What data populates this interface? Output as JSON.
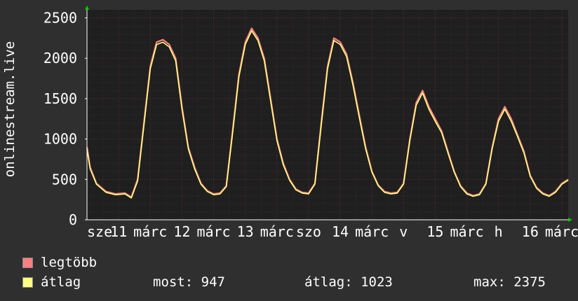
{
  "chart_data": {
    "type": "line",
    "ylabel": "onlinestream.live",
    "ylim": [
      0,
      2600
    ],
    "yticks": [
      0,
      500,
      1000,
      1500,
      2000,
      2500
    ],
    "xlim": [
      0,
      7.6
    ],
    "grid": true,
    "xtick_labels": [
      {
        "x": 0.0,
        "label": "sze"
      },
      {
        "x": 0.5,
        "label": "11"
      },
      {
        "x": 1.0,
        "label": "márc"
      },
      {
        "x": 1.5,
        "label": "12"
      },
      {
        "x": 2.0,
        "label": "márc"
      },
      {
        "x": 2.5,
        "label": "13"
      },
      {
        "x": 3.0,
        "label": "márc"
      },
      {
        "x": 3.5,
        "label": "szo"
      },
      {
        "x": 4.0,
        "label": "14"
      },
      {
        "x": 4.5,
        "label": "márc"
      },
      {
        "x": 5.0,
        "label": "v"
      },
      {
        "x": 5.5,
        "label": "15"
      },
      {
        "x": 6.0,
        "label": "márc"
      },
      {
        "x": 6.5,
        "label": "h"
      },
      {
        "x": 7.0,
        "label": "16"
      },
      {
        "x": 7.5,
        "label": "márc"
      }
    ],
    "series": [
      {
        "name": "legtöbb",
        "color": "#ff8080",
        "points": [
          [
            0.0,
            900
          ],
          [
            0.05,
            650
          ],
          [
            0.15,
            450
          ],
          [
            0.3,
            350
          ],
          [
            0.45,
            320
          ],
          [
            0.6,
            330
          ],
          [
            0.7,
            280
          ],
          [
            0.8,
            500
          ],
          [
            0.9,
            1200
          ],
          [
            1.0,
            1900
          ],
          [
            1.1,
            2200
          ],
          [
            1.2,
            2230
          ],
          [
            1.3,
            2170
          ],
          [
            1.4,
            2000
          ],
          [
            1.5,
            1400
          ],
          [
            1.6,
            900
          ],
          [
            1.7,
            650
          ],
          [
            1.8,
            450
          ],
          [
            1.9,
            360
          ],
          [
            2.0,
            320
          ],
          [
            2.1,
            330
          ],
          [
            2.2,
            420
          ],
          [
            2.3,
            1100
          ],
          [
            2.4,
            1800
          ],
          [
            2.5,
            2200
          ],
          [
            2.6,
            2370
          ],
          [
            2.7,
            2250
          ],
          [
            2.8,
            2000
          ],
          [
            2.9,
            1500
          ],
          [
            3.0,
            1000
          ],
          [
            3.1,
            700
          ],
          [
            3.2,
            500
          ],
          [
            3.3,
            380
          ],
          [
            3.4,
            340
          ],
          [
            3.5,
            330
          ],
          [
            3.6,
            450
          ],
          [
            3.7,
            1200
          ],
          [
            3.8,
            1900
          ],
          [
            3.9,
            2250
          ],
          [
            4.0,
            2200
          ],
          [
            4.1,
            2050
          ],
          [
            4.2,
            1700
          ],
          [
            4.3,
            1300
          ],
          [
            4.4,
            900
          ],
          [
            4.5,
            600
          ],
          [
            4.6,
            430
          ],
          [
            4.7,
            350
          ],
          [
            4.8,
            330
          ],
          [
            4.9,
            340
          ],
          [
            5.0,
            450
          ],
          [
            5.1,
            1000
          ],
          [
            5.2,
            1450
          ],
          [
            5.3,
            1600
          ],
          [
            5.4,
            1400
          ],
          [
            5.5,
            1250
          ],
          [
            5.6,
            1100
          ],
          [
            5.7,
            850
          ],
          [
            5.8,
            600
          ],
          [
            5.9,
            420
          ],
          [
            6.0,
            330
          ],
          [
            6.1,
            300
          ],
          [
            6.2,
            320
          ],
          [
            6.3,
            450
          ],
          [
            6.4,
            900
          ],
          [
            6.5,
            1250
          ],
          [
            6.6,
            1400
          ],
          [
            6.7,
            1250
          ],
          [
            6.8,
            1050
          ],
          [
            6.9,
            850
          ],
          [
            7.0,
            550
          ],
          [
            7.1,
            400
          ],
          [
            7.2,
            330
          ],
          [
            7.3,
            300
          ],
          [
            7.4,
            350
          ],
          [
            7.5,
            450
          ],
          [
            7.6,
            500
          ]
        ]
      },
      {
        "name": "átlag",
        "color": "#ffff80",
        "points": [
          [
            0.0,
            870
          ],
          [
            0.05,
            630
          ],
          [
            0.15,
            440
          ],
          [
            0.3,
            340
          ],
          [
            0.45,
            310
          ],
          [
            0.6,
            320
          ],
          [
            0.7,
            270
          ],
          [
            0.8,
            480
          ],
          [
            0.9,
            1170
          ],
          [
            1.0,
            1870
          ],
          [
            1.1,
            2170
          ],
          [
            1.2,
            2200
          ],
          [
            1.3,
            2140
          ],
          [
            1.4,
            1970
          ],
          [
            1.5,
            1370
          ],
          [
            1.6,
            880
          ],
          [
            1.7,
            630
          ],
          [
            1.8,
            440
          ],
          [
            1.9,
            350
          ],
          [
            2.0,
            310
          ],
          [
            2.1,
            320
          ],
          [
            2.2,
            410
          ],
          [
            2.3,
            1070
          ],
          [
            2.4,
            1770
          ],
          [
            2.5,
            2170
          ],
          [
            2.6,
            2340
          ],
          [
            2.7,
            2220
          ],
          [
            2.8,
            1970
          ],
          [
            2.9,
            1470
          ],
          [
            3.0,
            980
          ],
          [
            3.1,
            680
          ],
          [
            3.2,
            490
          ],
          [
            3.3,
            370
          ],
          [
            3.4,
            330
          ],
          [
            3.5,
            320
          ],
          [
            3.6,
            440
          ],
          [
            3.7,
            1170
          ],
          [
            3.8,
            1870
          ],
          [
            3.9,
            2220
          ],
          [
            4.0,
            2170
          ],
          [
            4.1,
            2020
          ],
          [
            4.2,
            1670
          ],
          [
            4.3,
            1270
          ],
          [
            4.4,
            880
          ],
          [
            4.5,
            590
          ],
          [
            4.6,
            420
          ],
          [
            4.7,
            340
          ],
          [
            4.8,
            320
          ],
          [
            4.9,
            330
          ],
          [
            5.0,
            440
          ],
          [
            5.1,
            980
          ],
          [
            5.2,
            1420
          ],
          [
            5.3,
            1570
          ],
          [
            5.4,
            1370
          ],
          [
            5.5,
            1220
          ],
          [
            5.6,
            1080
          ],
          [
            5.7,
            830
          ],
          [
            5.8,
            590
          ],
          [
            5.9,
            410
          ],
          [
            6.0,
            320
          ],
          [
            6.1,
            290
          ],
          [
            6.2,
            310
          ],
          [
            6.3,
            440
          ],
          [
            6.4,
            880
          ],
          [
            6.5,
            1220
          ],
          [
            6.6,
            1370
          ],
          [
            6.7,
            1220
          ],
          [
            6.8,
            1030
          ],
          [
            6.9,
            830
          ],
          [
            7.0,
            540
          ],
          [
            7.1,
            390
          ],
          [
            7.2,
            320
          ],
          [
            7.3,
            290
          ],
          [
            7.4,
            340
          ],
          [
            7.5,
            440
          ],
          [
            7.6,
            490
          ]
        ]
      }
    ]
  },
  "legend": {
    "items": [
      {
        "label": "legtöbb",
        "color": "#ff8080"
      },
      {
        "label": "átlag",
        "color": "#ffff80"
      }
    ]
  },
  "stats": {
    "now": "most: 947",
    "avg": "átlag: 1023",
    "max": "max: 2375"
  },
  "colors": {
    "background": "#2f2f2f",
    "plot_background": "#1f1f1f",
    "grid": "#5a3030",
    "axis": "#ffffff",
    "arrow": "#00cc00"
  }
}
